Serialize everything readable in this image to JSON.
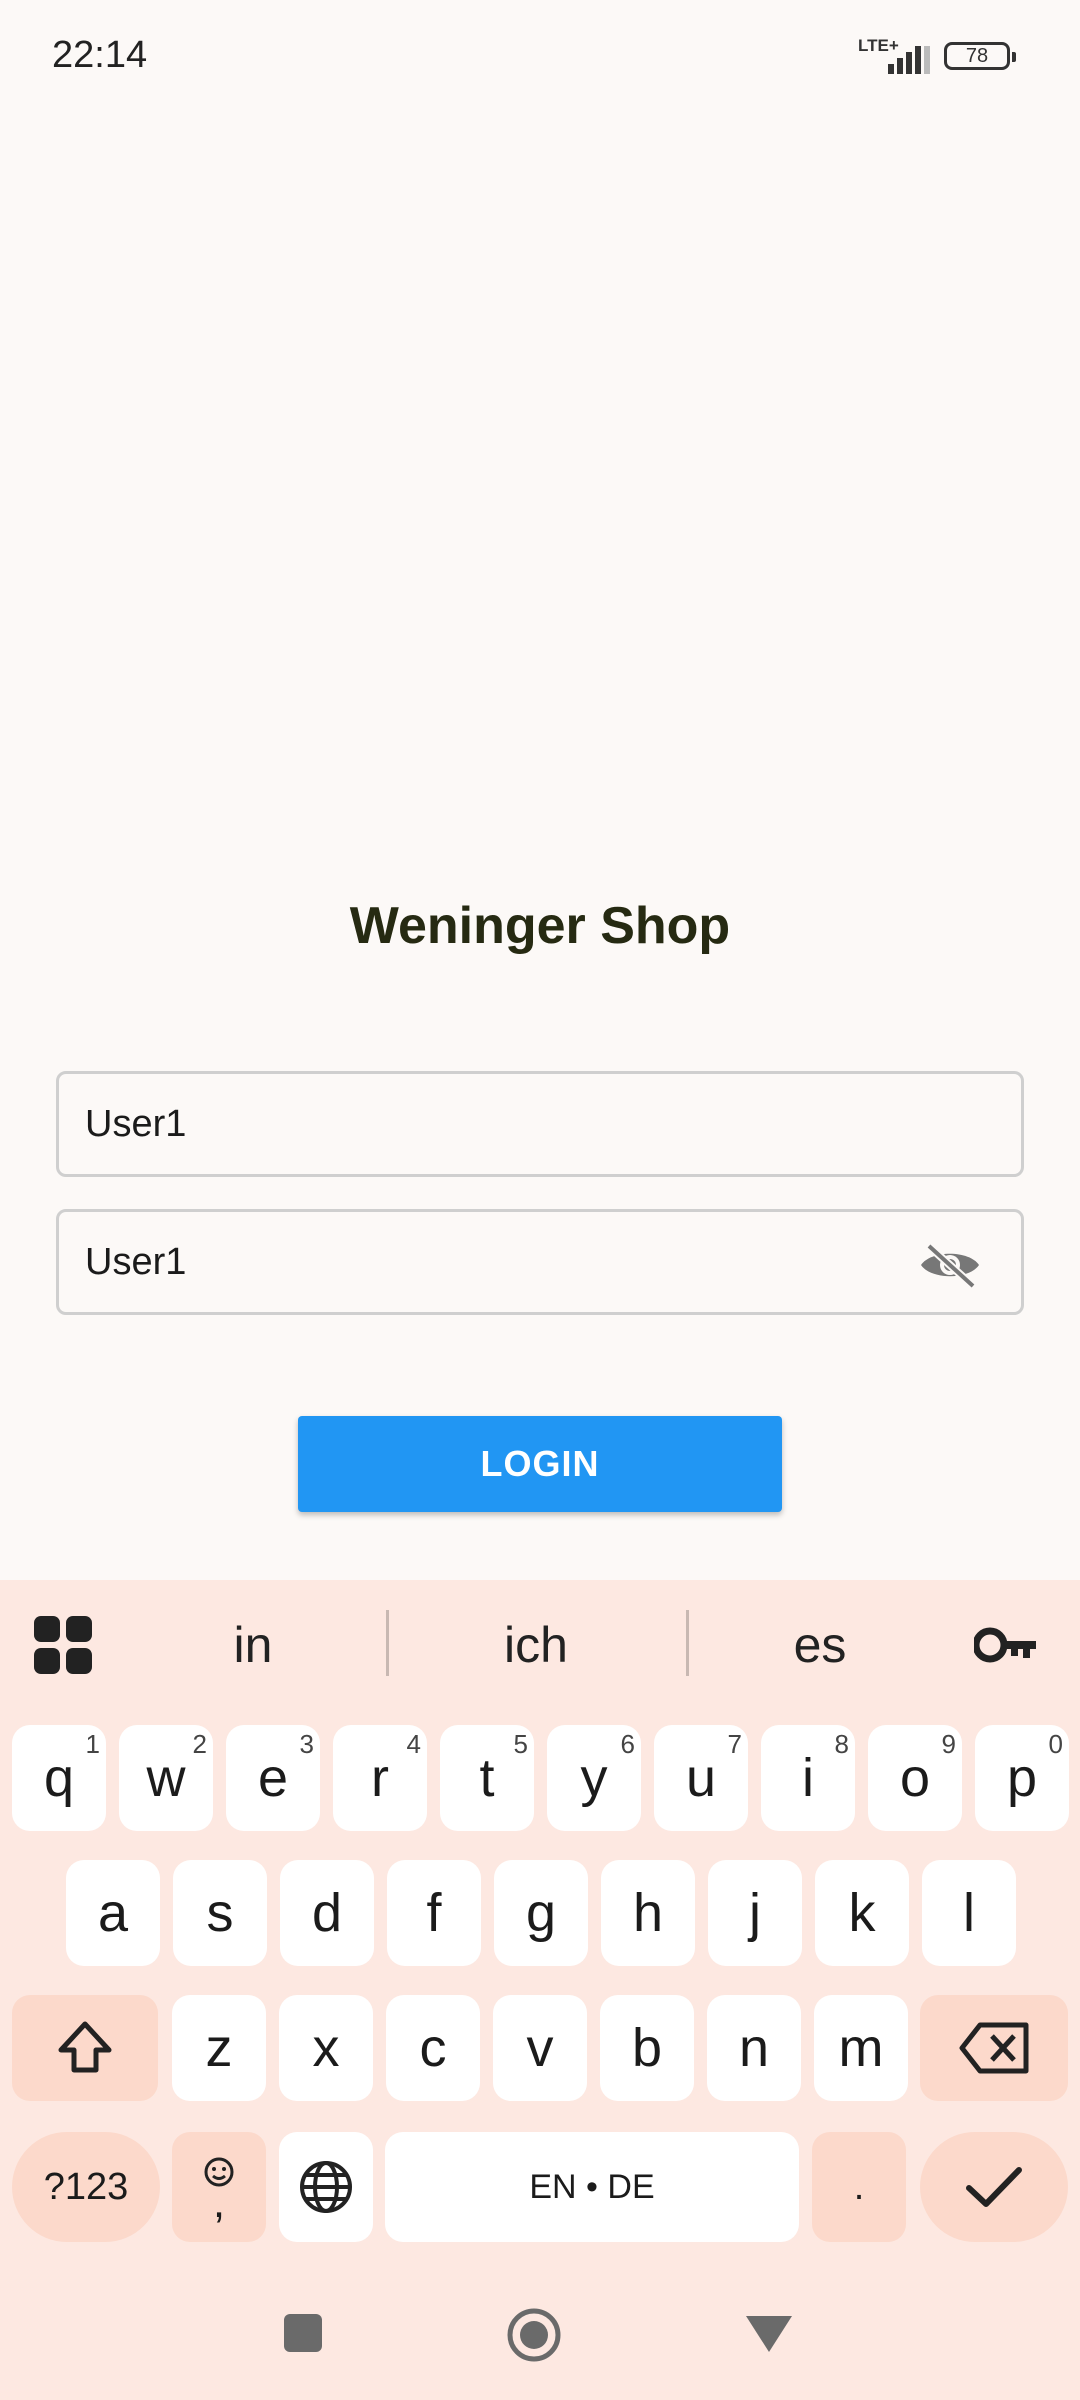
{
  "status_bar": {
    "time": "22:14",
    "network": "LTE+",
    "battery": "78"
  },
  "app": {
    "title": "Weninger Shop"
  },
  "form": {
    "username_value": "User1",
    "password_value": "User1",
    "login_label": "LOGIN"
  },
  "keyboard": {
    "suggestions": [
      "in",
      "ich",
      "es"
    ],
    "row1": [
      {
        "k": "q",
        "h": "1"
      },
      {
        "k": "w",
        "h": "2"
      },
      {
        "k": "e",
        "h": "3"
      },
      {
        "k": "r",
        "h": "4"
      },
      {
        "k": "t",
        "h": "5"
      },
      {
        "k": "y",
        "h": "6"
      },
      {
        "k": "u",
        "h": "7"
      },
      {
        "k": "i",
        "h": "8"
      },
      {
        "k": "o",
        "h": "9"
      },
      {
        "k": "p",
        "h": "0"
      }
    ],
    "row2": [
      "a",
      "s",
      "d",
      "f",
      "g",
      "h",
      "j",
      "k",
      "l"
    ],
    "row3": [
      "z",
      "x",
      "c",
      "v",
      "b",
      "n",
      "m"
    ],
    "symbols_label": "?123",
    "emoji_comma_label": ",",
    "space_label": "EN • DE",
    "period_label": "."
  },
  "icons": {
    "apps": "apps-grid-icon",
    "password_manager": "key-icon",
    "visibility": "eye-off-icon",
    "shift": "shift-icon",
    "backspace": "backspace-icon",
    "globe": "globe-icon",
    "enter": "checkmark-icon",
    "emoji": "smiley-icon"
  }
}
